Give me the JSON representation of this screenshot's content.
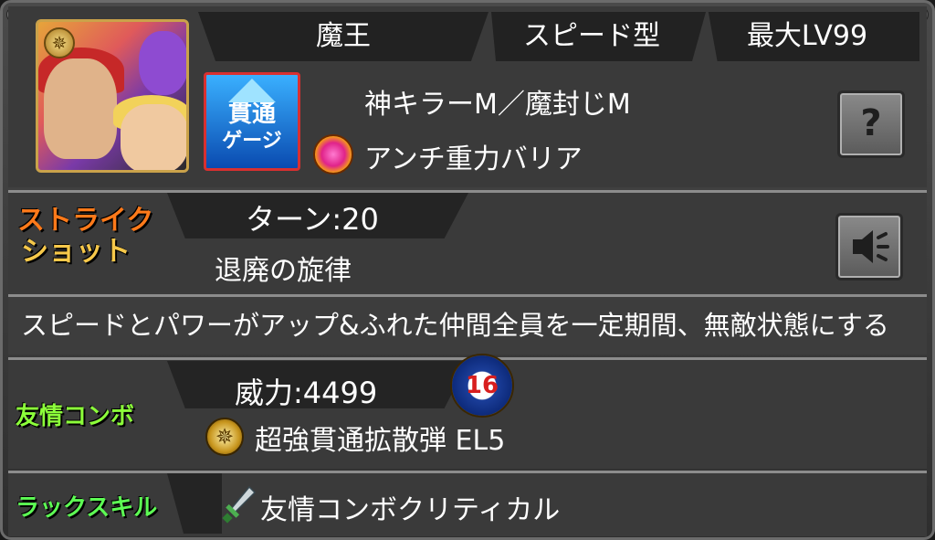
{
  "header": {
    "race": "魔王",
    "type": "スピード型",
    "max_level": "最大LV99"
  },
  "portrait": {
    "icon": "character-portrait",
    "rank_medal_icon": "gold-star-medal-icon"
  },
  "gimmick_badge": {
    "line1": "貫通",
    "line2": "ゲージ",
    "icon": "pierce-gauge-icon"
  },
  "abilities": {
    "killer": "神キラーM／魔封じM",
    "anti": "アンチ重力バリア",
    "anti_icon": "anti-gravity-barrier-icon"
  },
  "buttons": {
    "help_icon": "help-question-icon",
    "voice_icon": "speaker-icon"
  },
  "strike_shot": {
    "label_line1": "ストライク",
    "label_line2": "ショット",
    "turn": "ターン:20",
    "name": "退廃の旋律",
    "description": "スピードとパワーがアップ&ふれた仲間全員を一定期間、無敵状態にする"
  },
  "friendship_combo": {
    "label": "友情コンボ",
    "power": "威力:4499",
    "level_badge": "16",
    "name": "超強貫通拡散弾 EL5"
  },
  "luck_skill": {
    "label": "ラックスキル",
    "name": "友情コンボクリティカル"
  },
  "colors": {
    "strike_label": "#ff7a1a",
    "friendship_label": "#8cff3a",
    "luck_label": "#5dfb54",
    "gimmick_border": "#d83030"
  }
}
